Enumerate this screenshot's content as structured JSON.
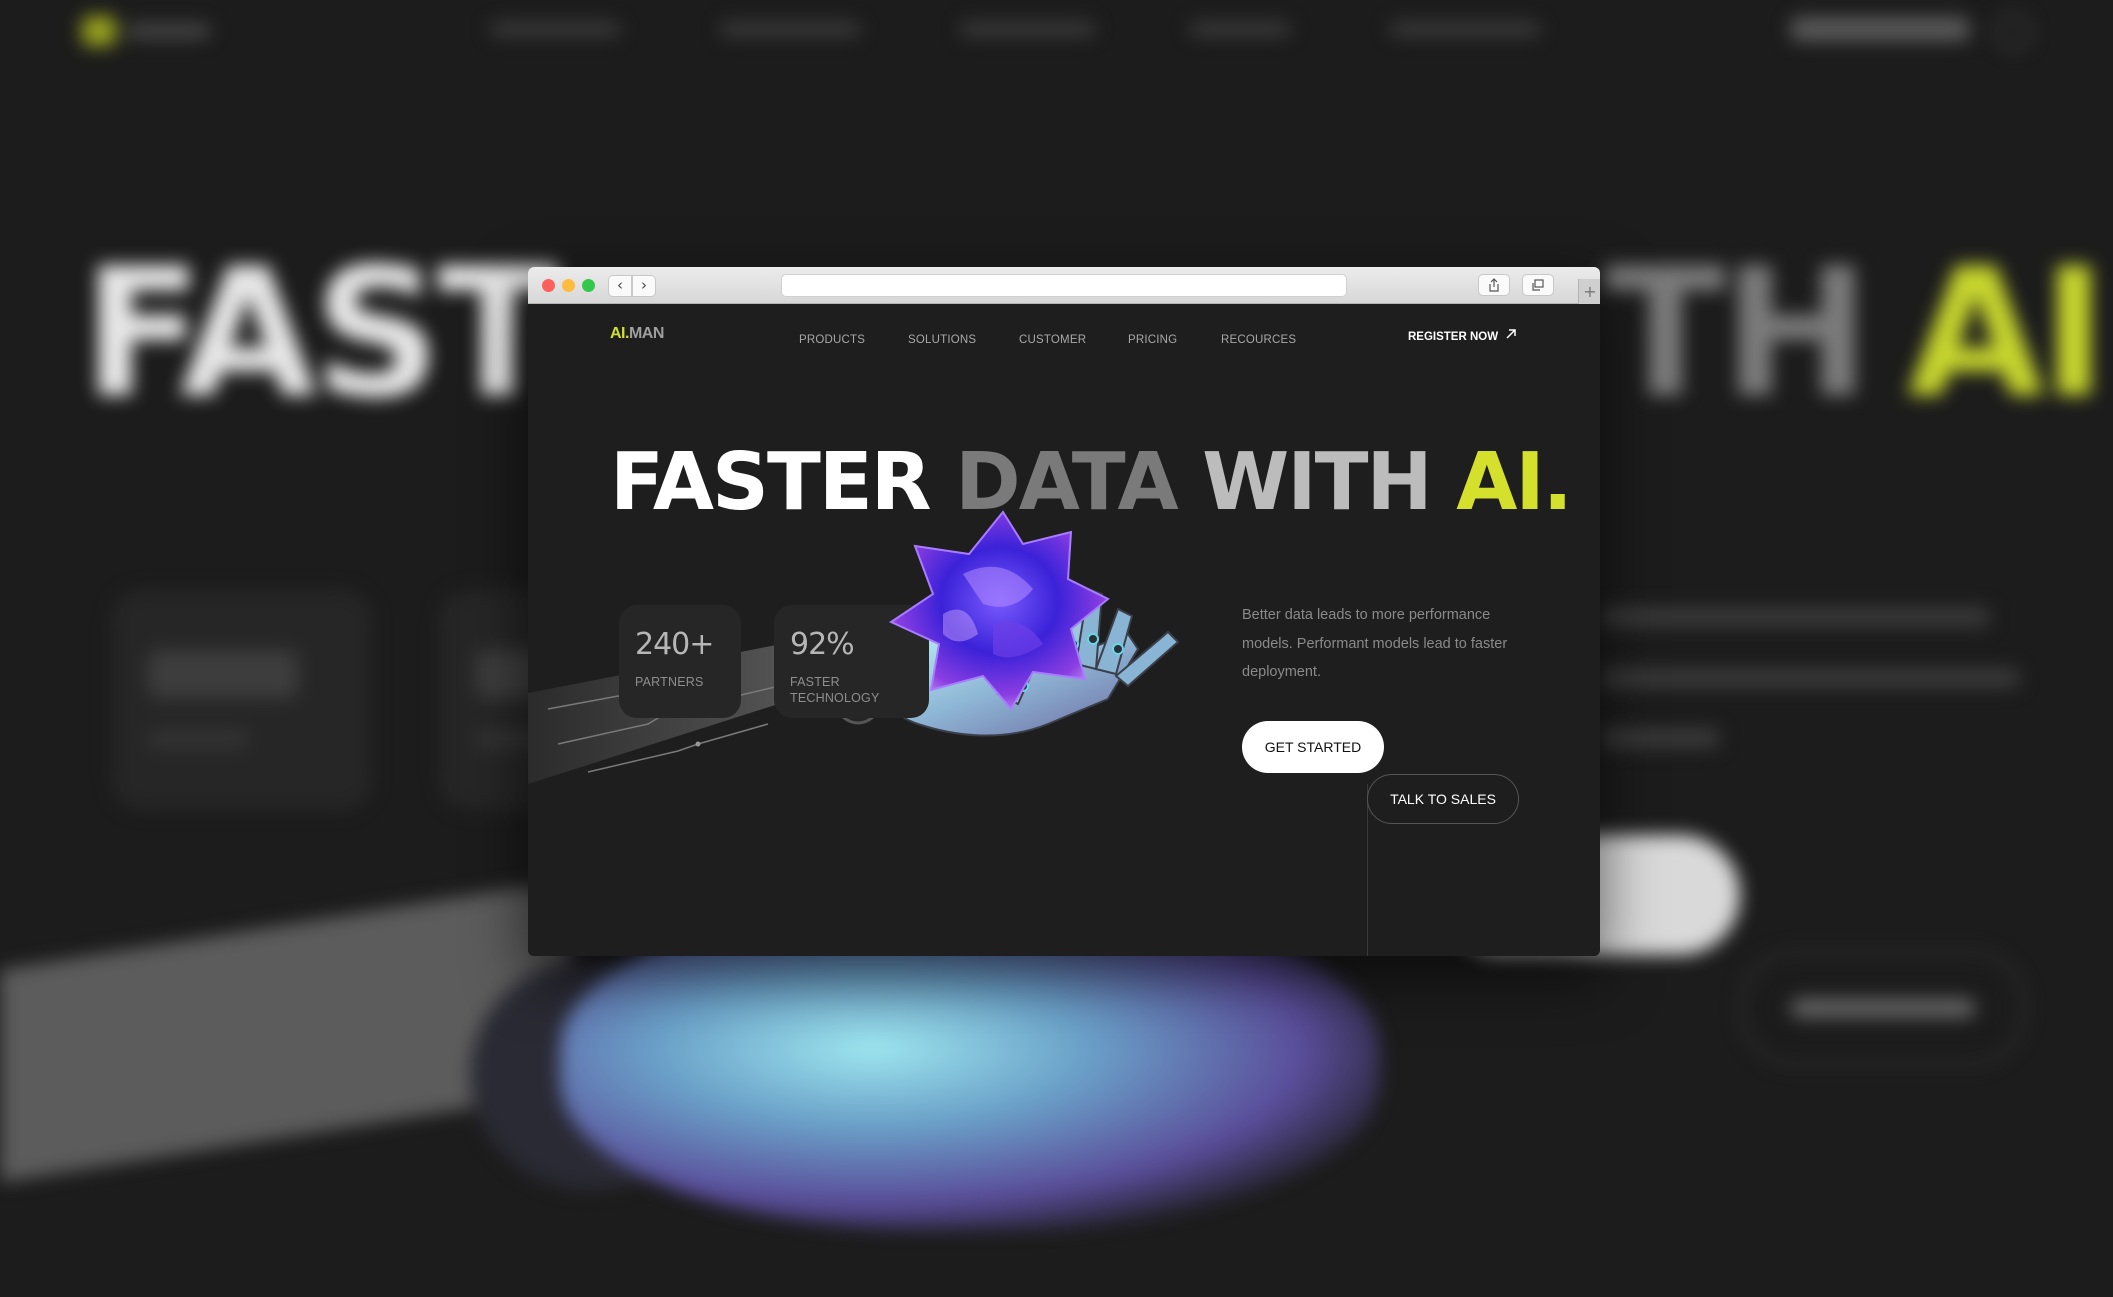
{
  "brand": {
    "accent": "#d4e02b",
    "background": "#1e1e1e"
  },
  "logo": {
    "ai": "AI.",
    "man": "MAN"
  },
  "nav": {
    "items": [
      "PRODUCTS",
      "SOLUTIONS",
      "CUSTOMER",
      "PRICING",
      "RECOURCES"
    ]
  },
  "header": {
    "register_label": "REGISTER NOW",
    "register_icon": "arrow-up-right-icon"
  },
  "hero": {
    "title_parts": [
      "FASTER",
      "DATA",
      "WITH",
      "AI."
    ],
    "stats": [
      {
        "value": "240+",
        "label": "PARTNERS"
      },
      {
        "value": "92%",
        "label_lines": [
          "FASTER",
          "TECHNOLOGY"
        ]
      }
    ],
    "description": "Better data leads to more performance models. Performant models lead to faster deployment.",
    "primary_cta": "GET STARTED",
    "secondary_cta": "TALK TO SALES"
  },
  "browser": {
    "controls": [
      "close",
      "minimize",
      "zoom"
    ],
    "back_icon": "chevron-left-icon",
    "forward_icon": "chevron-right-icon",
    "share_icon": "share-icon",
    "tabs_icon": "tabs-icon",
    "new_tab_icon": "plus-icon"
  },
  "backdrop": {
    "title_parts": [
      "FAST",
      "TH",
      "AI."
    ]
  }
}
